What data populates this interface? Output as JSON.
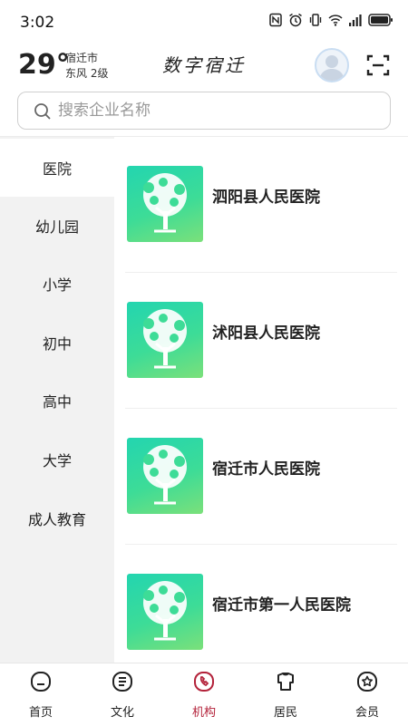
{
  "status_bar": {
    "time": "3:02"
  },
  "weather": {
    "temperature": "29°",
    "city": "宿迁市",
    "wind": "东风  2级"
  },
  "app": {
    "title": "数字宿迁"
  },
  "search": {
    "placeholder": "搜索企业名称",
    "value": ""
  },
  "sidebar": {
    "items": [
      {
        "label": "医院",
        "active": true
      },
      {
        "label": "幼儿园",
        "active": false
      },
      {
        "label": "小学",
        "active": false
      },
      {
        "label": "初中",
        "active": false
      },
      {
        "label": "高中",
        "active": false
      },
      {
        "label": "大学",
        "active": false
      },
      {
        "label": "成人教育",
        "active": false
      }
    ]
  },
  "institutions": [
    {
      "name": "泗阳县人民医院"
    },
    {
      "name": "沭阳县人民医院"
    },
    {
      "name": "宿迁市人民医院"
    },
    {
      "name": "宿迁市第一人民医院"
    }
  ],
  "tabbar": {
    "tabs": [
      {
        "label": "首页",
        "icon": "home-icon"
      },
      {
        "label": "文化",
        "icon": "culture-icon"
      },
      {
        "label": "机构",
        "icon": "institution-icon",
        "active": true
      },
      {
        "label": "居民",
        "icon": "resident-icon"
      },
      {
        "label": "会员",
        "icon": "member-icon"
      }
    ]
  },
  "colors": {
    "accent": "#b3223a",
    "thumb_gradient_start": "#23d5b0",
    "thumb_gradient_end": "#7be07a"
  }
}
